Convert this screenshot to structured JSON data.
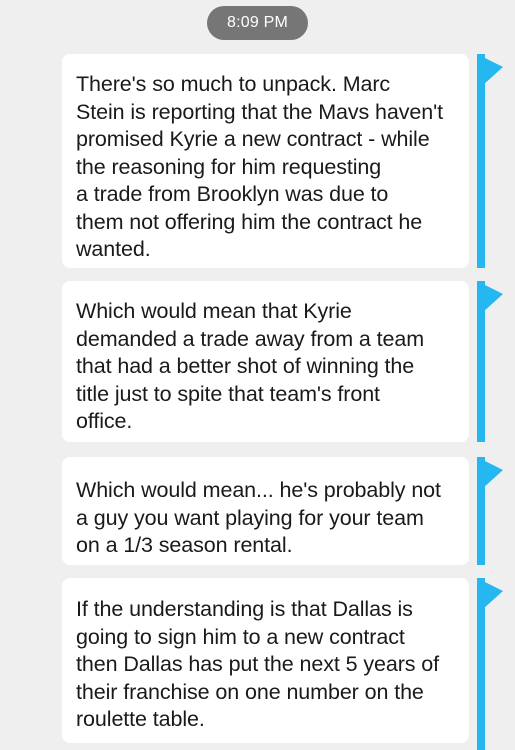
{
  "timestamp": "8:09 PM",
  "accent_color": "#25b7f0",
  "messages": [
    {
      "text": "There's so much to unpack. Marc\nStein is reporting that the Mavs haven't\npromised Kyrie a new contract - while\nthe reasoning for him requesting\na trade from Brooklyn was due to\nthem not offering him the contract he\nwanted."
    },
    {
      "text": "Which would mean that Kyrie\ndemanded a trade away from a team\nthat had a better shot of winning the\ntitle just to spite that team's front\noffice."
    },
    {
      "text": "Which would mean... he's probably not\na guy you want playing for your team\non a 1/3 season rental."
    },
    {
      "text": "If the understanding is that Dallas is\ngoing to sign him to a new contract\nthen Dallas has put the next 5 years of\ntheir franchise on one number on the\nroulette table."
    }
  ]
}
